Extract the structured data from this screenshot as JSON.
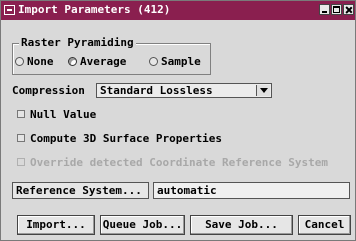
{
  "window": {
    "title": "Import Parameters (412)"
  },
  "raster_pyramiding": {
    "label": "Raster Pyramiding",
    "options": [
      {
        "label": "None",
        "selected": false
      },
      {
        "label": "Average",
        "selected": true
      },
      {
        "label": "Sample",
        "selected": false
      }
    ]
  },
  "compression": {
    "label": "Compression",
    "value": "Standard Lossless"
  },
  "checks": {
    "null_value": "Null Value",
    "compute_3d": "Compute 3D Surface Properties",
    "override_crs": "Override detected Coordinate Reference System"
  },
  "reference_system": {
    "button": "Reference System...",
    "value": "automatic"
  },
  "buttons": {
    "import": "Import...",
    "queue_job": "Queue Job...",
    "save_job": "Save Job...",
    "cancel": "Cancel"
  },
  "colors": {
    "titlebar": "#8a1f4f",
    "background": "#d9d9d9"
  }
}
